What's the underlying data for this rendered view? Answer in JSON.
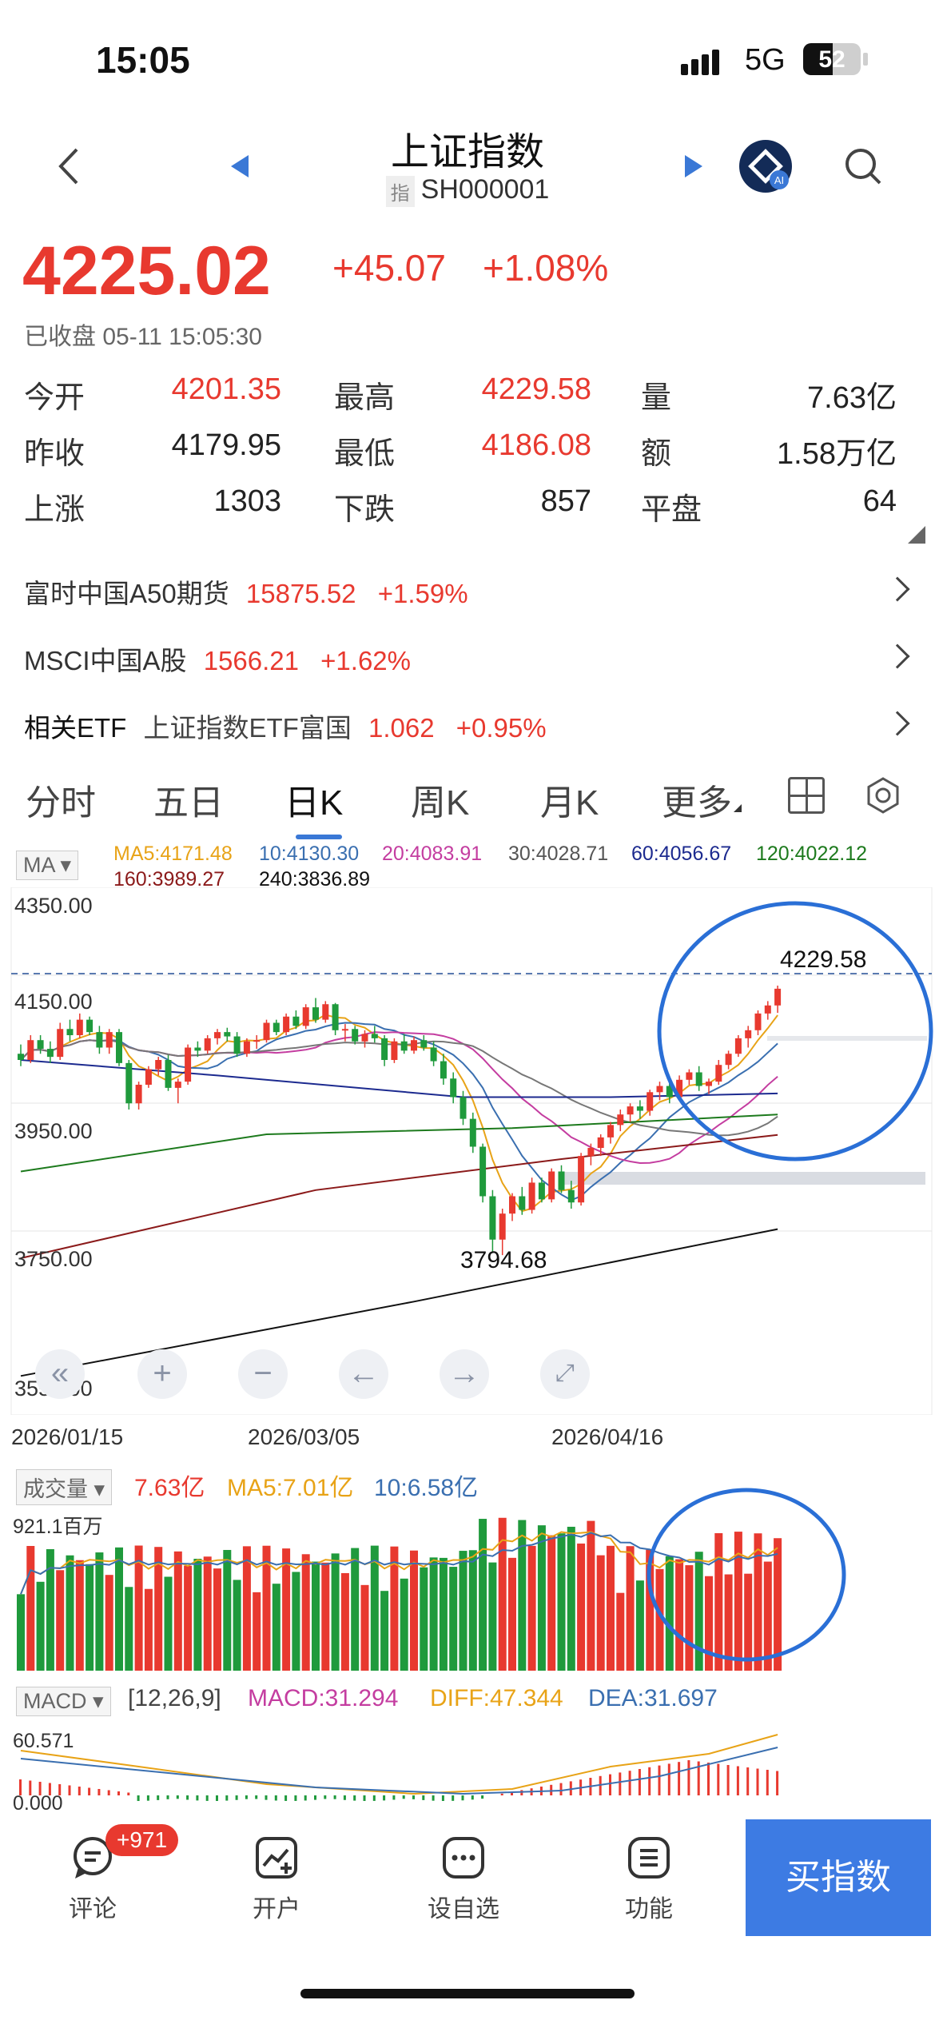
{
  "status_bar": {
    "time": "15:05",
    "network": "5G",
    "battery": "52"
  },
  "header": {
    "title": "上证指数",
    "tag": "指",
    "code": "SH000001"
  },
  "quote": {
    "price": "4225.02",
    "change": "+45.07",
    "change_pct": "+1.08%",
    "status_label": "已收盘",
    "datetime": "05-11 15:05:30"
  },
  "stats": [
    {
      "label": "今开",
      "value": "4201.35",
      "color": "red"
    },
    {
      "label": "最高",
      "value": "4229.58",
      "color": "red"
    },
    {
      "label": "量",
      "value": "7.63亿",
      "color": "black"
    },
    {
      "label": "昨收",
      "value": "4179.95",
      "color": "black"
    },
    {
      "label": "最低",
      "value": "4186.08",
      "color": "red"
    },
    {
      "label": "额",
      "value": "1.58万亿",
      "color": "black"
    },
    {
      "label": "上涨",
      "value": "1303",
      "color": "black"
    },
    {
      "label": "下跌",
      "value": "857",
      "color": "black"
    },
    {
      "label": "平盘",
      "value": "64",
      "color": "black"
    }
  ],
  "related": [
    {
      "name": "富时中国A50期货",
      "price": "15875.52",
      "pct": "+1.59%"
    },
    {
      "name": "MSCI中国A股",
      "price": "1566.21",
      "pct": "+1.62%"
    },
    {
      "name": "相关ETF",
      "sub": "上证指数ETF富国",
      "price": "1.062",
      "pct": "+0.95%"
    }
  ],
  "tabs": [
    "分时",
    "五日",
    "日K",
    "周K",
    "月K",
    "更多"
  ],
  "active_tab": "日K",
  "ma_legend": {
    "selector": "MA",
    "items": [
      {
        "label": "MA5:4171.48",
        "color": "#e8a317"
      },
      {
        "label": "10:4130.30",
        "color": "#3a6fb0"
      },
      {
        "label": "20:4083.91",
        "color": "#c43da0"
      },
      {
        "label": "30:4028.71",
        "color": "#666666"
      },
      {
        "label": "60:4056.67",
        "color": "#1c2a8f"
      },
      {
        "label": "120:4022.12",
        "color": "#1d7a1d"
      },
      {
        "label": "160:3989.27",
        "color": "#8b1a1a"
      },
      {
        "label": "240:3836.89",
        "color": "#111111"
      }
    ]
  },
  "kline_chart": {
    "y_ticks": [
      "4350.00",
      "4150.00",
      "3950.00",
      "3750.00",
      "3550.00"
    ],
    "dates": [
      "2026/01/15",
      "2026/03/05",
      "2026/04/16"
    ],
    "high_label": "4229.58",
    "low_label": "3794.68"
  },
  "volume": {
    "selector": "成交量",
    "vol": "7.63亿",
    "ma5": "MA5:7.01亿",
    "ma10": "10:6.58亿",
    "axis_top": "921.1百万"
  },
  "macd": {
    "selector": "MACD",
    "params": "[12,26,9]",
    "macd": "MACD:31.294",
    "diff": "DIFF:47.344",
    "dea": "DEA:31.697",
    "axis_top": "60.571",
    "axis_bottom": "0.000"
  },
  "bottom_nav": [
    {
      "label": "评论",
      "icon": "comment-icon",
      "badge": "+971"
    },
    {
      "label": "开户",
      "icon": "account-open-icon"
    },
    {
      "label": "设自选",
      "icon": "add-watchlist-icon"
    },
    {
      "label": "功能",
      "icon": "menu-icon"
    }
  ],
  "buy_button": "买指数",
  "colors": {
    "up": "#e8392f",
    "down": "#1f9a3c",
    "accent": "#3d7be3",
    "annotation": "#2a6fd6"
  },
  "chart_data": {
    "type": "candlestick",
    "x_start": "2026/01/15",
    "ylim": [
      3550,
      4350
    ],
    "ohlc": [
      [
        4120,
        4135,
        4100,
        4110
      ],
      [
        4110,
        4150,
        4105,
        4142
      ],
      [
        4142,
        4150,
        4120,
        4128
      ],
      [
        4128,
        4140,
        4105,
        4115
      ],
      [
        4115,
        4170,
        4110,
        4160
      ],
      [
        4160,
        4175,
        4140,
        4150
      ],
      [
        4150,
        4185,
        4145,
        4175
      ],
      [
        4175,
        4180,
        4150,
        4155
      ],
      [
        4155,
        4165,
        4120,
        4130
      ],
      [
        4130,
        4160,
        4120,
        4155
      ],
      [
        4155,
        4160,
        4100,
        4105
      ],
      [
        4105,
        4110,
        4030,
        4040
      ],
      [
        4040,
        4075,
        4030,
        4070
      ],
      [
        4070,
        4100,
        4065,
        4095
      ],
      [
        4095,
        4115,
        4085,
        4110
      ],
      [
        4110,
        4118,
        4060,
        4065
      ],
      [
        4065,
        4080,
        4040,
        4075
      ],
      [
        4075,
        4135,
        4070,
        4130
      ],
      [
        4130,
        4140,
        4115,
        4125
      ],
      [
        4125,
        4150,
        4120,
        4145
      ],
      [
        4145,
        4160,
        4135,
        4155
      ],
      [
        4155,
        4162,
        4140,
        4148
      ],
      [
        4148,
        4155,
        4115,
        4120
      ],
      [
        4120,
        4145,
        4115,
        4140
      ],
      [
        4140,
        4150,
        4128,
        4142
      ],
      [
        4142,
        4175,
        4138,
        4170
      ],
      [
        4170,
        4175,
        4150,
        4155
      ],
      [
        4155,
        4185,
        4150,
        4180
      ],
      [
        4180,
        4190,
        4160,
        4165
      ],
      [
        4165,
        4200,
        4160,
        4195
      ],
      [
        4195,
        4210,
        4170,
        4175
      ],
      [
        4175,
        4205,
        4170,
        4200
      ],
      [
        4200,
        4202,
        4150,
        4158
      ],
      [
        4158,
        4168,
        4140,
        4160
      ],
      [
        4160,
        4165,
        4135,
        4140
      ],
      [
        4140,
        4158,
        4130,
        4152
      ],
      [
        4152,
        4165,
        4138,
        4145
      ],
      [
        4145,
        4150,
        4100,
        4110
      ],
      [
        4110,
        4145,
        4105,
        4140
      ],
      [
        4140,
        4152,
        4120,
        4125
      ],
      [
        4125,
        4148,
        4120,
        4142
      ],
      [
        4142,
        4150,
        4125,
        4130
      ],
      [
        4130,
        4140,
        4100,
        4108
      ],
      [
        4108,
        4120,
        4070,
        4080
      ],
      [
        4080,
        4090,
        4040,
        4050
      ],
      [
        4050,
        4060,
        4005,
        4015
      ],
      [
        4015,
        4025,
        3960,
        3970
      ],
      [
        3970,
        3975,
        3880,
        3890
      ],
      [
        3890,
        3900,
        3800,
        3820
      ],
      [
        3820,
        3870,
        3795,
        3862
      ],
      [
        3862,
        3895,
        3850,
        3890
      ],
      [
        3890,
        3905,
        3860,
        3868
      ],
      [
        3868,
        3920,
        3862,
        3912
      ],
      [
        3912,
        3920,
        3880,
        3885
      ],
      [
        3885,
        3935,
        3880,
        3930
      ],
      [
        3930,
        3940,
        3895,
        3900
      ],
      [
        3900,
        3915,
        3870,
        3880
      ],
      [
        3880,
        3960,
        3875,
        3955
      ],
      [
        3955,
        3975,
        3940,
        3968
      ],
      [
        3968,
        3990,
        3955,
        3985
      ],
      [
        3985,
        4010,
        3975,
        4005
      ],
      [
        4005,
        4030,
        3995,
        4022
      ],
      [
        4022,
        4040,
        4010,
        4035
      ],
      [
        4035,
        4045,
        4015,
        4028
      ],
      [
        4028,
        4062,
        4020,
        4058
      ],
      [
        4058,
        4075,
        4045,
        4068
      ],
      [
        4068,
        4080,
        4040,
        4050
      ],
      [
        4050,
        4085,
        4045,
        4078
      ],
      [
        4078,
        4095,
        4070,
        4090
      ],
      [
        4090,
        4100,
        4060,
        4068
      ],
      [
        4068,
        4080,
        4055,
        4075
      ],
      [
        4075,
        4110,
        4070,
        4102
      ],
      [
        4102,
        4125,
        4095,
        4120
      ],
      [
        4120,
        4150,
        4115,
        4145
      ],
      [
        4145,
        4165,
        4130,
        4158
      ],
      [
        4158,
        4190,
        4150,
        4185
      ],
      [
        4185,
        4205,
        4175,
        4198
      ],
      [
        4198,
        4230,
        4186,
        4225
      ]
    ]
  }
}
